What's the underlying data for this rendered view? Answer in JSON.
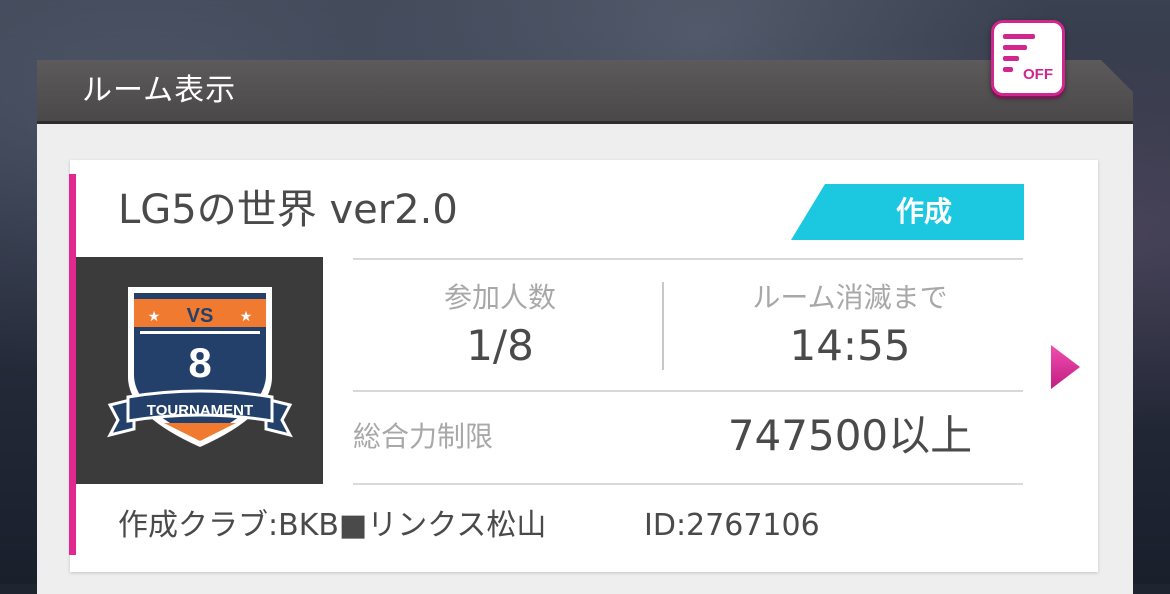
{
  "header": {
    "title": "ルーム表示",
    "filter_button": {
      "icon": "filter-lines-icon",
      "state_label": "OFF"
    }
  },
  "room": {
    "name": "LG5の世界 ver2.0",
    "badge_label": "作成",
    "emblem": {
      "icon": "vs-8-tournament-shield-icon",
      "vs_text": "VS",
      "number": "8",
      "ribbon_text": "TOURNAMENT"
    },
    "participants": {
      "label": "参加人数",
      "value": "1/8"
    },
    "expire": {
      "label": "ルーム消滅まで",
      "value": "14:55"
    },
    "power_limit": {
      "label": "総合力制限",
      "value": "747500以上"
    },
    "club": "作成クラブ:BKB■リンクス松山",
    "room_id": "ID:2767106",
    "next_icon": "chevron-right-icon"
  },
  "colors": {
    "accent_pink": "#e0288f",
    "badge_cyan": "#1cc8e0",
    "header_gray": "#545152",
    "emblem_navy": "#22406a",
    "emblem_orange": "#f07a30"
  }
}
